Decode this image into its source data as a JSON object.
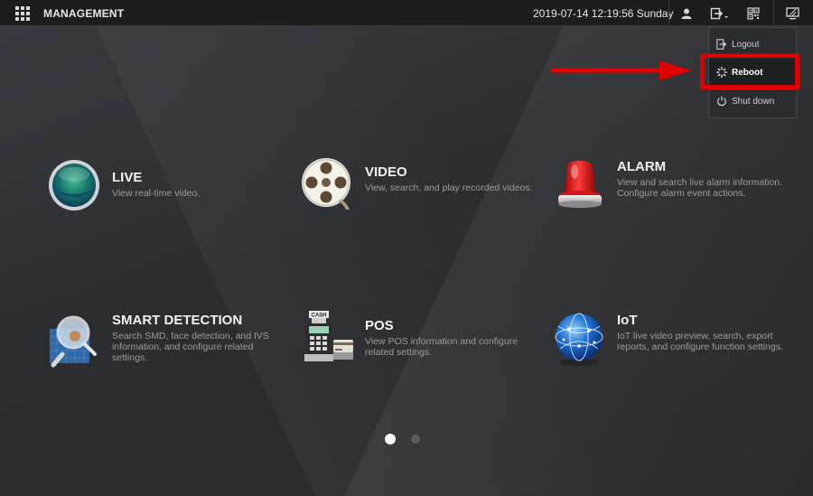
{
  "header": {
    "title": "MANAGEMENT",
    "datetime": "2019-07-14 12:19:56 Sunday",
    "icons": [
      "grid-menu-icon",
      "user-icon",
      "logout-dropdown-icon",
      "qr-code-icon",
      "display-icon"
    ]
  },
  "dropdown": {
    "items": [
      {
        "label": "Logout",
        "icon": "logout-icon"
      },
      {
        "label": "Reboot",
        "icon": "reboot-icon",
        "selected": true
      },
      {
        "label": "Shut down",
        "icon": "power-icon"
      }
    ]
  },
  "annotation": {
    "box_color": "#e00000",
    "arrow_color": "#e00000"
  },
  "tiles": [
    {
      "title": "LIVE",
      "desc": "View real-time video.",
      "icon": "live-globe-icon"
    },
    {
      "title": "VIDEO",
      "desc": "View, search, and play recorded videos.",
      "icon": "film-reel-icon"
    },
    {
      "title": "ALARM",
      "desc": "View and search live alarm information. Configure alarm event actions.",
      "icon": "alarm-siren-icon"
    },
    {
      "title": "SMART DETECTION",
      "desc": "Search SMD, face detection, and IVS information, and configure related settings.",
      "icon": "magnifier-icon"
    },
    {
      "title": "POS",
      "desc": "View POS information and configure related settings.",
      "icon": "cash-register-icon"
    },
    {
      "title": "IoT",
      "desc": "IoT live video preview, search, export reports, and configure function settings.",
      "icon": "iot-globe-icon"
    }
  ],
  "pager": {
    "pages": 2,
    "current": 1
  }
}
